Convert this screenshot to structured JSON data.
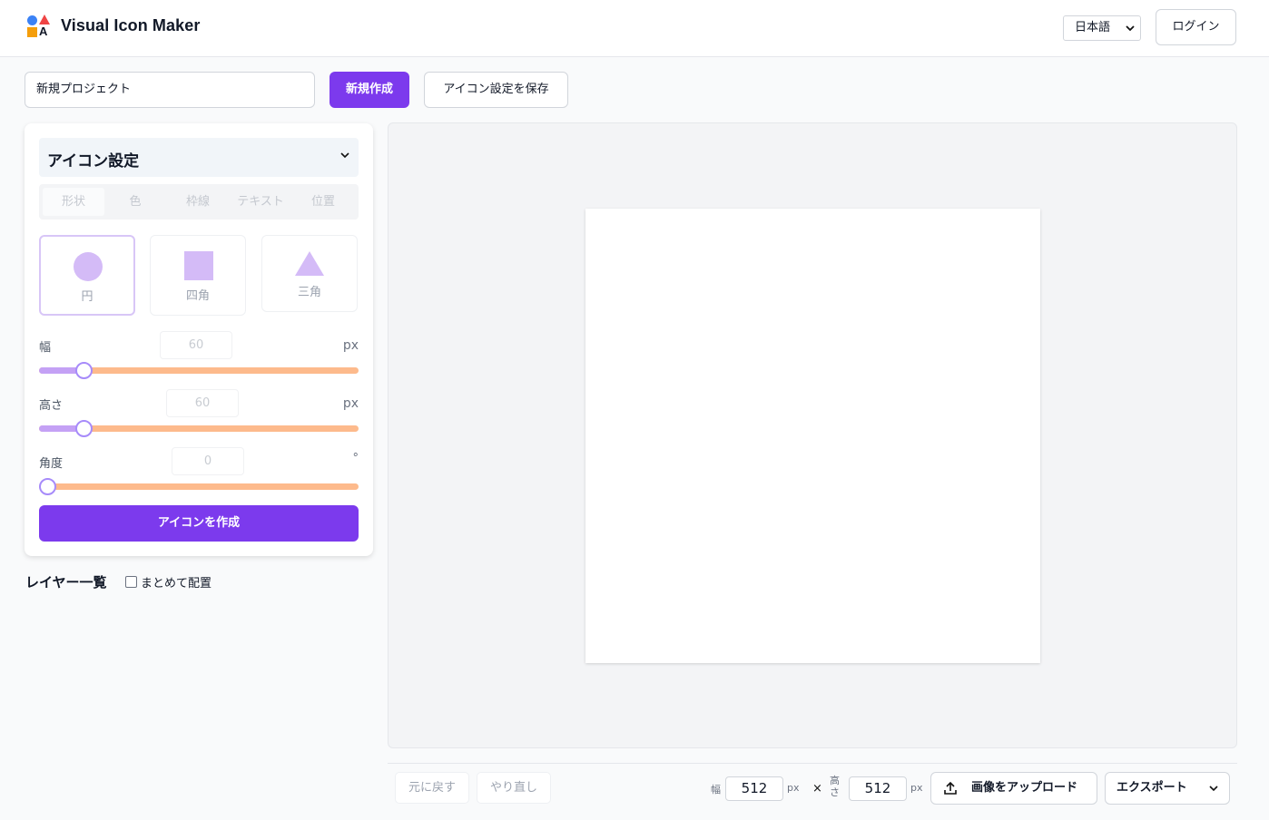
{
  "header": {
    "app_title": "Visual Icon Maker",
    "language": "日本語",
    "login_label": "ログイン"
  },
  "toolbar": {
    "project_name": "新規プロジェクト",
    "new_label": "新規作成",
    "save_label": "アイコン設定を保存"
  },
  "panel": {
    "title": "アイコン設定",
    "tabs": [
      "形状",
      "色",
      "枠線",
      "テキスト",
      "位置"
    ],
    "shapes": [
      "円",
      "四角",
      "三角"
    ],
    "selected_shape": "円",
    "sliders": [
      {
        "label": "幅",
        "value": "60",
        "unit": "px",
        "fraction": 0.12
      },
      {
        "label": "高さ",
        "value": "60",
        "unit": "px",
        "fraction": 0.12
      },
      {
        "label": "角度",
        "value": "0",
        "unit": "°",
        "fraction": 0.0
      }
    ],
    "create_label": "アイコンを作成"
  },
  "layers": {
    "title": "レイヤー一覧",
    "group_label": "まとめて配置",
    "group_checked": false
  },
  "bottom": {
    "undo_label": "元に戻す",
    "redo_label": "やり直し",
    "width_label": "幅",
    "width_value": "512",
    "height_label": "高さ",
    "height_value": "512",
    "unit": "px",
    "times": "×",
    "upload_label": "画像をアップロード",
    "export_label": "エクスポート"
  },
  "colors": {
    "accent": "#7c3aed",
    "shape_fill": "#d4bbf7",
    "slider_track": "#fdba8c",
    "slider_fill": "#c4a1f5"
  }
}
